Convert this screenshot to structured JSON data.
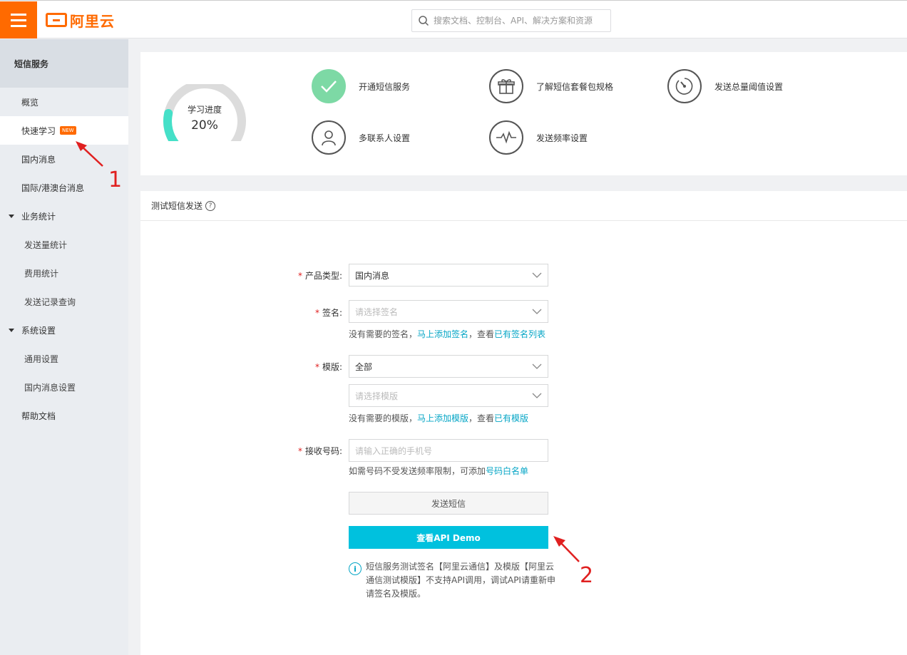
{
  "header": {
    "logo_text": "阿里云",
    "search_placeholder": "搜索文档、控制台、API、解决方案和资源"
  },
  "sidebar": {
    "title": "短信服务",
    "items": [
      {
        "label": "概览"
      },
      {
        "label": "快速学习",
        "badge": "NEW"
      },
      {
        "label": "国内消息"
      },
      {
        "label": "国际/港澳台消息"
      }
    ],
    "groups": [
      {
        "label": "业务统计",
        "children": [
          "发送量统计",
          "费用统计",
          "发送记录查询"
        ]
      },
      {
        "label": "系统设置",
        "children": [
          "通用设置",
          "国内消息设置"
        ]
      }
    ],
    "help": "帮助文档"
  },
  "progress": {
    "label": "学习进度",
    "percent_text": "20%",
    "value": 0.2
  },
  "steps": [
    {
      "label": "开通短信服务",
      "icon": "check-icon",
      "done": true
    },
    {
      "label": "了解短信套餐包规格",
      "icon": "gift-icon",
      "done": false
    },
    {
      "label": "发送总量阈值设置",
      "icon": "gauge-icon",
      "done": false
    },
    {
      "label": "多联系人设置",
      "icon": "user-icon",
      "done": false
    },
    {
      "label": "发送频率设置",
      "icon": "pulse-icon",
      "done": false
    }
  ],
  "test_section": {
    "title": "测试短信发送",
    "help": "?"
  },
  "form": {
    "req_mark": "*",
    "product_type_label": "产品类型:",
    "product_type_value": "国内消息",
    "sign_label": "签名:",
    "sign_placeholder": "请选择签名",
    "sign_hint_prefix": "没有需要的签名，",
    "sign_hint_link1": "马上添加签名",
    "sign_hint_mid": "，查看",
    "sign_hint_link2": "已有签名列表",
    "template_label": "模版:",
    "template_value": "全部",
    "template_placeholder": "请选择模版",
    "template_hint_prefix": "没有需要的模版，",
    "template_hint_link1": "马上添加模版",
    "template_hint_mid": "，查看",
    "template_hint_link2": "已有模版",
    "phone_label": "接收号码:",
    "phone_placeholder": "请输入正确的手机号",
    "phone_hint_prefix": "如需号码不受发送频率限制，可添加",
    "phone_hint_link": "号码白名单",
    "send_button": "发送短信",
    "demo_button": "查看API Demo",
    "info_icon": "i",
    "note": "短信服务测试签名【阿里云通信】及模版【阿里云通信测试模版】不支持API调用，调试API请重新申请签名及模版。"
  },
  "annotations": {
    "one": "1",
    "two": "2"
  },
  "colors": {
    "brand": "#ff6a00",
    "accent": "#00c1de",
    "link": "#06a6c6",
    "done": "#7dd9a5",
    "annotation": "#e02020"
  }
}
